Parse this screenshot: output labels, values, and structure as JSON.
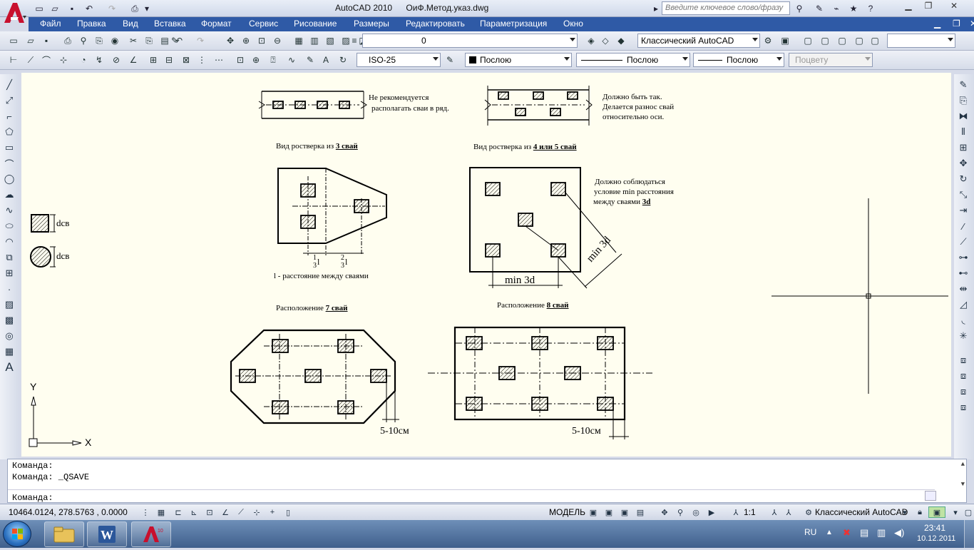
{
  "window": {
    "app_name": "AutoCAD 2010",
    "file_name": "ОиФ.Метод.указ.dwg",
    "search_placeholder": "Введите ключевое слово/фразу"
  },
  "menu": [
    "Файл",
    "Правка",
    "Вид",
    "Вставка",
    "Формат",
    "Сервис",
    "Рисование",
    "Размеры",
    "Редактировать",
    "Параметризация",
    "Окно"
  ],
  "toolbar1": {
    "layer_value": "0",
    "workspace_value": "Классический AutoCAD"
  },
  "toolbar2": {
    "dimstyle_value": "ISO-25",
    "color_value": "Послою",
    "linetype_value": "Послою",
    "lineweight_value": "Послою",
    "plotstyle_value": "Поцвету"
  },
  "drawing": {
    "note1": [
      "Не рекомендуется",
      "располагать сваи в ряд."
    ],
    "note2": [
      "Должно быть так.",
      "Делается разнос свай",
      "относительно оси."
    ],
    "cap3_prefix": "Вид ростверка из ",
    "cap3_bold": "3 свай",
    "cap45_prefix": "Вид ростверка из ",
    "cap45_bold": "4 или 5 свай",
    "note3": [
      "Должно соблюдаться",
      "условие min расстояния",
      "между сваями "
    ],
    "note3_bold": "3d",
    "frac1_num": "1",
    "frac1_den": "3",
    "frac1_l": "l",
    "frac2_num": "2",
    "frac2_den": "3",
    "frac2_l": "l",
    "l_caption": "l - расстояние между сваями",
    "min3d_h": "min 3d",
    "min3d_d": "min 3d",
    "cap7_prefix": "Расположение ",
    "cap7_bold": "7 свай",
    "cap8_prefix": "Расположение ",
    "cap8_bold": "8 свай",
    "dim_left": "5-10см",
    "dim_right": "5-10см",
    "dsv1": "dсв",
    "dsv2": "dсв",
    "ucs_y": "Y",
    "ucs_x": "X"
  },
  "command": {
    "line1": "Команда:",
    "line2": "Команда:  _QSAVE",
    "prompt": "Команда:"
  },
  "status": {
    "coords": "10464.0124, 278.5763 , 0.0000",
    "model": "МОДЕЛЬ",
    "scale": "1:1",
    "workspace": "Классический AutoCAD"
  },
  "taskbar": {
    "lang": "RU",
    "time": "23:41",
    "date": "10.12.2011"
  },
  "colors": {
    "menubar": "#2f5aa6",
    "canvas": "#fffef0",
    "app_red": "#c8102e"
  }
}
